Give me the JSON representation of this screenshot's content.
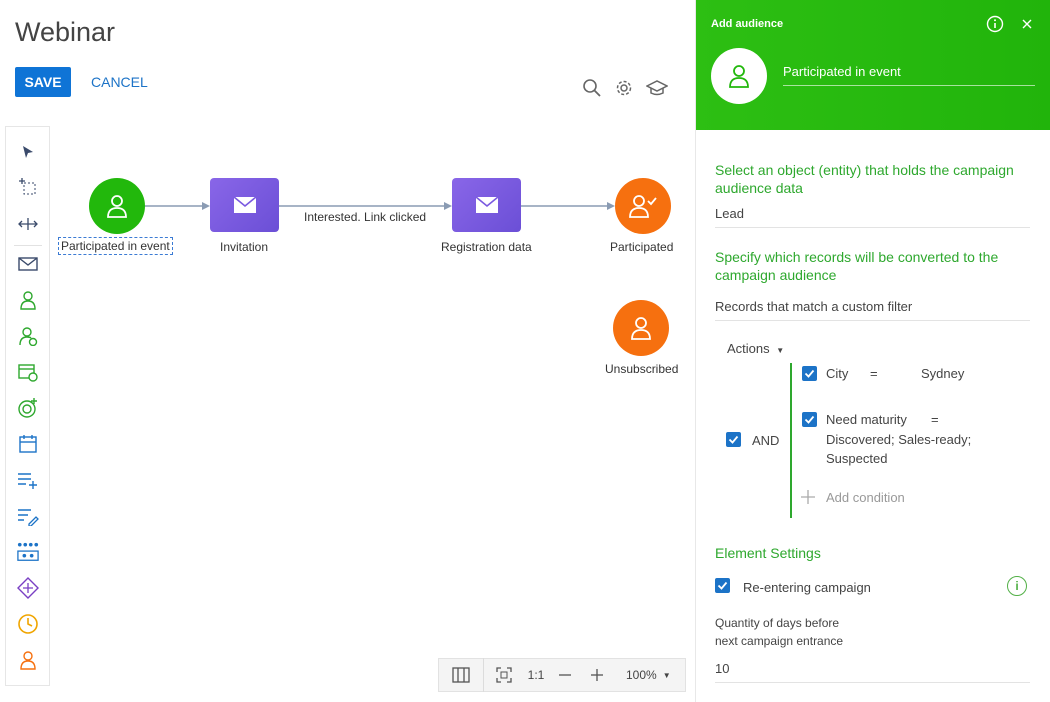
{
  "page": {
    "title": "Webinar"
  },
  "toolbar": {
    "save_label": "SAVE",
    "cancel_label": "CANCEL"
  },
  "top_icons": [
    "search-icon",
    "gear-icon",
    "graduation-cap-icon"
  ],
  "toolbox": {
    "items": [
      "pointer-icon",
      "select-area-icon",
      "move-icon",
      "email-icon",
      "audience-icon",
      "audience-event-icon",
      "calendar-event-icon",
      "target-add-icon",
      "calendar-icon",
      "add-record-icon",
      "edit-record-icon",
      "process-icon",
      "split-icon",
      "timer-icon",
      "exit-audience-icon"
    ]
  },
  "flow": {
    "nodes": [
      {
        "label": "Participated in event",
        "color": "#22b80c"
      },
      {
        "label": "Invitation",
        "color": "#7a59e0"
      },
      {
        "label": "Registration data",
        "color": "#7a59e0"
      },
      {
        "label": "Participated",
        "color": "#f6700f"
      },
      {
        "label": "Unsubscribed",
        "color": "#f6700f"
      }
    ],
    "edge_label": "Interested. Link clicked"
  },
  "zoom": {
    "ratio_label": "1:1",
    "value": "100%"
  },
  "panel": {
    "header_title": "Add audience",
    "name": "Participated in event",
    "object_section_title": "Select an object (entity) that holds the campaign audience data",
    "object_value": "Lead",
    "records_section_title": "Specify which records will be converted to the campaign audience",
    "records_value": "Records that match a custom filter",
    "actions_label": "Actions",
    "and_label": "AND",
    "conditions": [
      {
        "field": "City",
        "operator": "=",
        "value": "Sydney"
      },
      {
        "field": "Need maturity",
        "operator": "=",
        "value_lines": [
          "Discovered; Sales-ready;",
          "Suspected"
        ]
      }
    ],
    "add_condition_label": "Add condition",
    "element_settings_title": "Element Settings",
    "reentering_label": "Re-entering campaign",
    "days_label_line1": "Quantity of days before",
    "days_label_line2": "next campaign entrance",
    "days_value": "10"
  }
}
